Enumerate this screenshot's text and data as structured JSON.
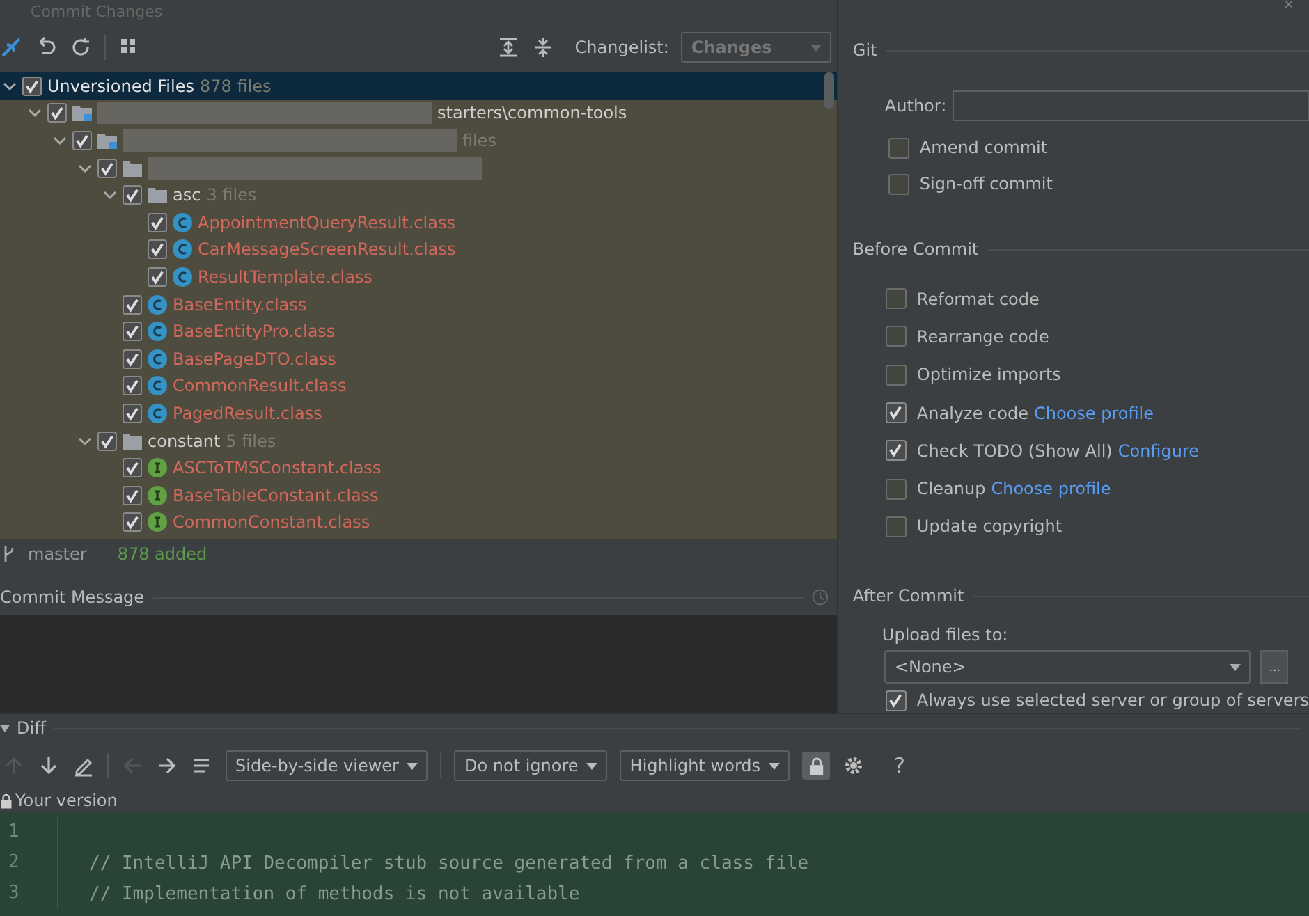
{
  "window": {
    "title": "Commit Changes"
  },
  "toolbar": {
    "changelist_label": "Changelist:",
    "changelist_value": "Changes"
  },
  "tree": [
    {
      "kind": "group",
      "name": "Unversioned Files",
      "count": "878 files",
      "checked": true,
      "expanded": true,
      "selected": true,
      "children": [
        {
          "kind": "module",
          "name": "starters\\common-tools",
          "blurred": true,
          "checked": true,
          "expanded": true,
          "selected": false,
          "children": [
            {
              "kind": "module",
              "count": "files",
              "blurred": true,
              "checked": true,
              "expanded": true,
              "selected": false,
              "children": [
                {
                  "kind": "folder",
                  "blurred": true,
                  "checked": true,
                  "expanded": true,
                  "selected": false,
                  "children": [
                    {
                      "kind": "folder",
                      "name": "asc",
                      "count": "3 files",
                      "checked": true,
                      "expanded": true,
                      "selected": false,
                      "children": [
                        {
                          "kind": "class",
                          "name": "AppointmentQueryResult.class",
                          "checked": true,
                          "selected": false
                        },
                        {
                          "kind": "class",
                          "name": "CarMessageScreenResult.class",
                          "checked": true,
                          "selected": false
                        },
                        {
                          "kind": "class",
                          "name": "ResultTemplate.class",
                          "checked": true,
                          "selected": false
                        }
                      ]
                    },
                    {
                      "kind": "class",
                      "name": "BaseEntity.class",
                      "checked": true,
                      "selected": false
                    },
                    {
                      "kind": "class",
                      "name": "BaseEntityPro.class",
                      "checked": true,
                      "selected": false
                    },
                    {
                      "kind": "class",
                      "name": "BasePageDTO.class",
                      "checked": true,
                      "selected": false
                    },
                    {
                      "kind": "class",
                      "name": "CommonResult.class",
                      "checked": true,
                      "selected": false
                    },
                    {
                      "kind": "class",
                      "name": "PagedResult.class",
                      "checked": true,
                      "selected": false
                    }
                  ]
                },
                {
                  "kind": "folder",
                  "name": "constant",
                  "count": "5 files",
                  "checked": true,
                  "expanded": true,
                  "selected": false,
                  "children": [
                    {
                      "kind": "interface",
                      "name": "ASCToTMSConstant.class",
                      "checked": true,
                      "selected": false
                    },
                    {
                      "kind": "interface",
                      "name": "BaseTableConstant.class",
                      "checked": true,
                      "selected": false
                    },
                    {
                      "kind": "interface",
                      "name": "CommonConstant.class",
                      "checked": true,
                      "selected": false
                    }
                  ]
                }
              ]
            }
          ]
        }
      ]
    }
  ],
  "status": {
    "branch": "master",
    "summary": "878 added"
  },
  "commit_message": {
    "label": "Commit Message"
  },
  "git": {
    "title": "Git",
    "author_label": "Author:",
    "options": [
      {
        "label": "Amend commit",
        "checked": false
      },
      {
        "label": "Sign-off commit",
        "checked": false
      }
    ]
  },
  "before_commit": {
    "title": "Before Commit",
    "options": [
      {
        "label": "Reformat code",
        "checked": false
      },
      {
        "label": "Rearrange code",
        "checked": false
      },
      {
        "label": "Optimize imports",
        "checked": false
      },
      {
        "label": "Analyze code",
        "link": "Choose profile",
        "checked": true
      },
      {
        "label": "Check TODO (Show All)",
        "link": "Configure",
        "checked": true
      },
      {
        "label": "Cleanup",
        "link": "Choose profile",
        "checked": false
      },
      {
        "label": "Update copyright",
        "checked": false
      }
    ]
  },
  "after_commit": {
    "title": "After Commit",
    "upload_label": "Upload files to:",
    "upload_value": "<None>",
    "browse_button": "...",
    "options": [
      {
        "label": "Always use selected server or group of servers",
        "checked": true
      }
    ]
  },
  "diff": {
    "title": "Diff",
    "expanded": true,
    "viewer": "Side-by-side viewer",
    "ignore": "Do not ignore",
    "highlight": "Highlight words",
    "help": "?",
    "version_label": "Your version",
    "lines": [
      {
        "number": "1"
      },
      {
        "number": "2",
        "text": "// IntelliJ API Decompiler stub source generated from a class file"
      },
      {
        "number": "3",
        "text": "// Implementation of methods is not available"
      }
    ]
  }
}
